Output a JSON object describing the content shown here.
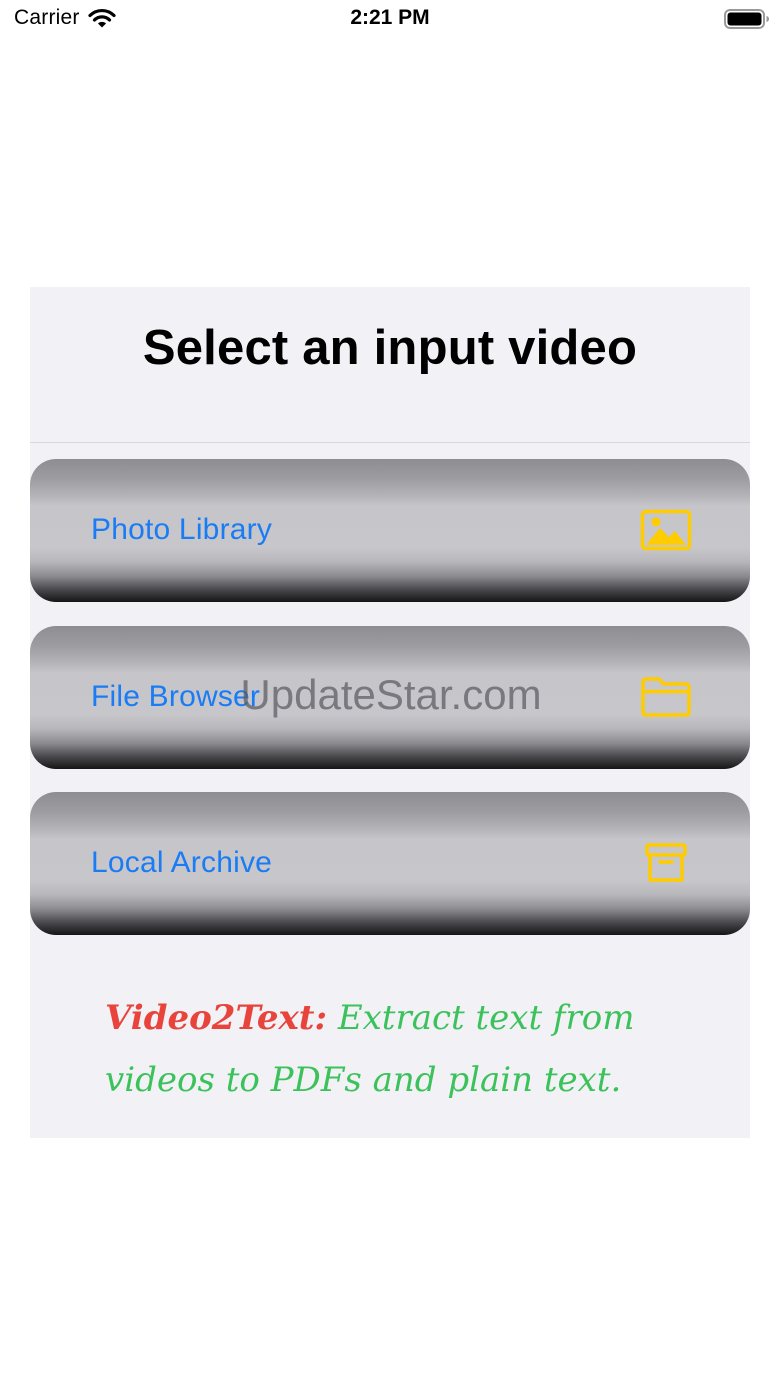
{
  "status_bar": {
    "carrier": "Carrier",
    "time": "2:21 PM"
  },
  "card": {
    "title": "Select an input video",
    "options": [
      {
        "label": "Photo Library",
        "icon": "photo-icon"
      },
      {
        "label": "File Browser",
        "icon": "folder-icon"
      },
      {
        "label": "Local Archive",
        "icon": "archive-box-icon"
      }
    ],
    "tagline": {
      "brand": "Video2Text:",
      "text": "Extract text from videos to PDFs and plain text."
    }
  },
  "watermark": "UpdateStar.com",
  "colors": {
    "accent_blue": "#1a7cf4",
    "icon_yellow": "#ffcc00",
    "tagline_red": "#e8443b",
    "tagline_green": "#3cc25a",
    "card_background": "#f1f1f6"
  }
}
